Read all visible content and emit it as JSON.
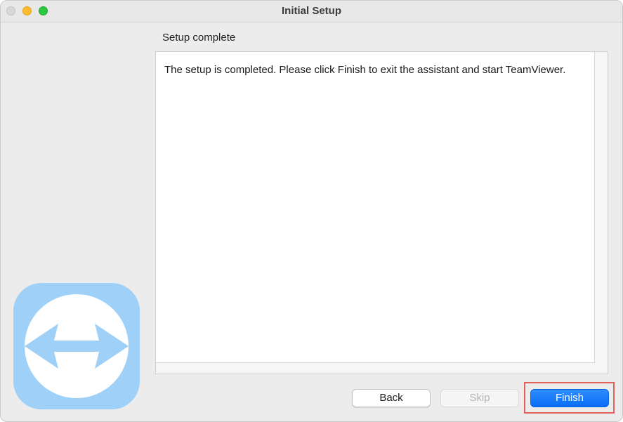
{
  "window": {
    "title": "Initial Setup"
  },
  "section": {
    "title": "Setup complete"
  },
  "content": {
    "message": "The setup is completed. Please click Finish to exit the assistant and start TeamViewer."
  },
  "logo": {
    "icon": "teamviewer-arrows-icon",
    "color": "#9ed0f8"
  },
  "buttons": {
    "back": "Back",
    "skip": "Skip",
    "finish": "Finish"
  },
  "colors": {
    "accent": "#0a6ef5",
    "highlight": "#e2625c"
  }
}
